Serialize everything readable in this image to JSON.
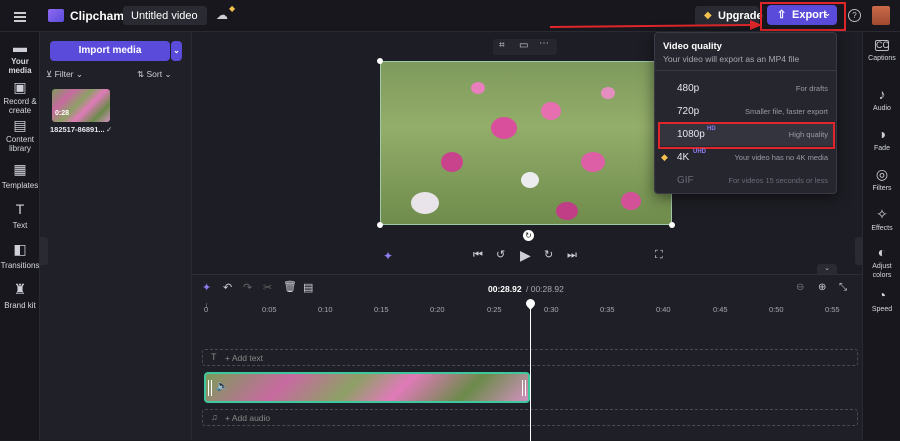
{
  "app": {
    "name": "Clipchamp",
    "project_title": "Untitled video"
  },
  "header": {
    "upgrade_label": "Upgrade",
    "export_label": "Export"
  },
  "left_nav": [
    {
      "label": "Your media",
      "icon": "folder-icon"
    },
    {
      "label": "Record & create",
      "icon": "camera-icon"
    },
    {
      "label": "Content library",
      "icon": "library-icon"
    },
    {
      "label": "Templates",
      "icon": "templates-icon"
    },
    {
      "label": "Text",
      "icon": "text-icon"
    },
    {
      "label": "Transitions",
      "icon": "transitions-icon"
    },
    {
      "label": "Brand kit",
      "icon": "brand-icon"
    }
  ],
  "media_panel": {
    "import_label": "Import media",
    "filter_label": "Filter",
    "sort_label": "Sort",
    "clip": {
      "duration": "0:28",
      "filename": "182517-86891..."
    }
  },
  "right_nav": [
    {
      "label": "Captions",
      "icon": "cc-icon"
    },
    {
      "label": "Audio",
      "icon": "speaker-icon"
    },
    {
      "label": "Fade",
      "icon": "fade-icon"
    },
    {
      "label": "Filters",
      "icon": "filters-icon"
    },
    {
      "label": "Effects",
      "icon": "wand-icon"
    },
    {
      "label": "Adjust colors",
      "icon": "adjust-icon"
    },
    {
      "label": "Speed",
      "icon": "speed-icon"
    }
  ],
  "export_menu": {
    "title": "Video quality",
    "subtitle": "Your video will export as an MP4 file",
    "options": [
      {
        "name": "480p",
        "badge": "",
        "desc": "For drafts"
      },
      {
        "name": "720p",
        "badge": "",
        "desc": "Smaller file, faster export"
      },
      {
        "name": "1080p",
        "badge": "HD",
        "desc": "High quality"
      },
      {
        "name": "4K",
        "badge": "UHD",
        "desc": "Your video has no 4K media"
      },
      {
        "name": "GIF",
        "badge": "",
        "desc": "For videos 15 seconds or less"
      }
    ]
  },
  "timeline": {
    "current_time": "00:28.92",
    "total_time": "/ 00:28.92",
    "ticks": [
      "0",
      "0:05",
      "0:10",
      "0:15",
      "0:20",
      "0:25",
      "0:30",
      "0:35",
      "0:40",
      "0:45",
      "0:50",
      "0:55"
    ],
    "add_text_label": "+ Add text",
    "add_audio_label": "+ Add audio"
  },
  "colors": {
    "accent": "#5b4bdb",
    "highlight": "#e0262a",
    "clip_border": "#3fc7a0"
  }
}
